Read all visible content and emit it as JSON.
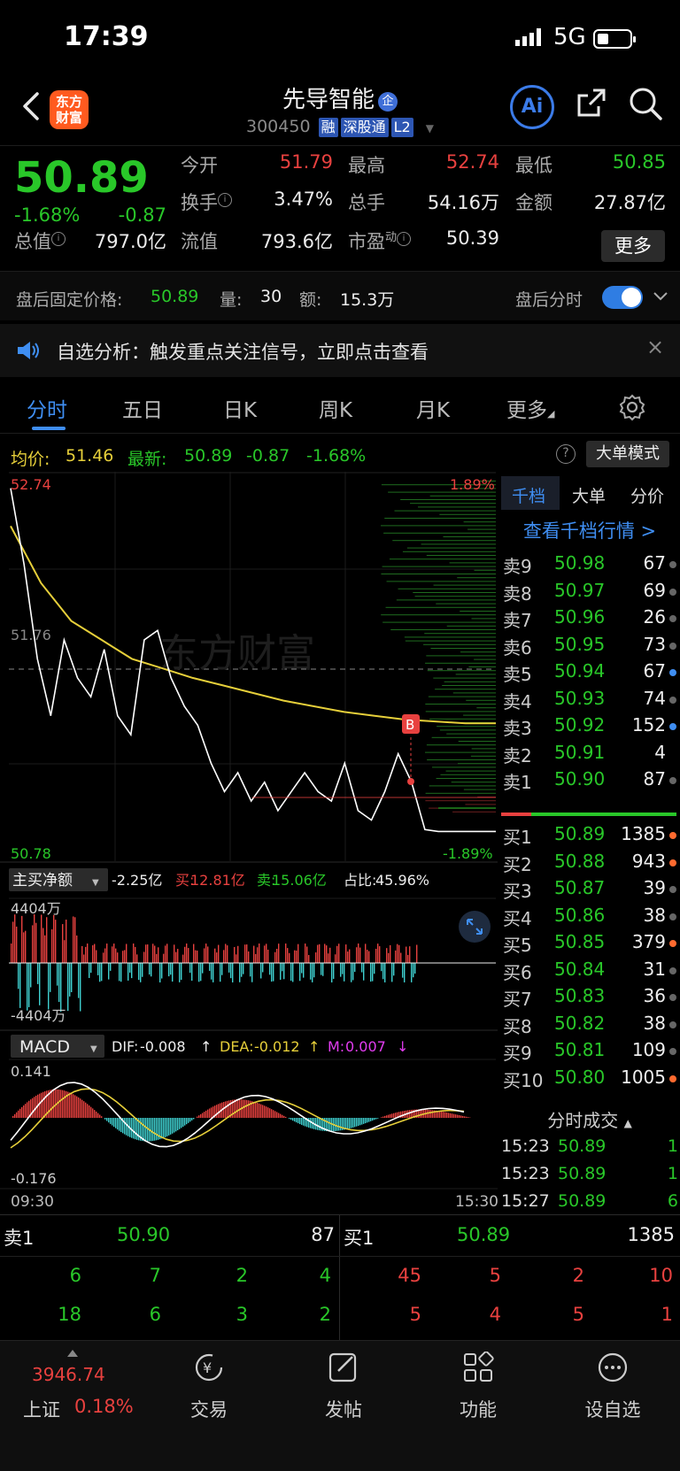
{
  "status_bar": {
    "time": "17:39",
    "network": "5G"
  },
  "header": {
    "app_logo_text": "东方财富",
    "stock_name": "先导智能",
    "stock_badge": "企",
    "stock_code": "300450",
    "tags": [
      "融",
      "深股通",
      "L2"
    ],
    "ai_label": "Ai"
  },
  "quote": {
    "last_price": "50.89",
    "change_pct": "-1.68%",
    "change_amt": "-0.87",
    "fields": [
      {
        "label": "今开",
        "value": "51.79",
        "color": "red"
      },
      {
        "label": "最高",
        "value": "52.74",
        "color": "red"
      },
      {
        "label": "最低",
        "value": "50.85",
        "color": "green"
      },
      {
        "label": "换手",
        "value": "3.47%",
        "color": "white"
      },
      {
        "label": "总手",
        "value": "54.16万",
        "color": "white"
      },
      {
        "label": "金额",
        "value": "27.87亿",
        "color": "white"
      },
      {
        "label": "总值",
        "value": "797.0亿",
        "color": "white"
      },
      {
        "label": "流值",
        "value": "793.6亿",
        "color": "white"
      },
      {
        "label": "市盈",
        "value": "50.39",
        "color": "white"
      }
    ],
    "pe_superscript": "动",
    "more_label": "更多"
  },
  "after_hours": {
    "label": "盘后固定价格:",
    "price": "50.89",
    "vol_label": "量:",
    "vol": "30",
    "amt_label": "额:",
    "amt": "15.3万",
    "toggle_label": "盘后分时",
    "toggle_on": true
  },
  "notice": {
    "text": "自选分析：触发重点关注信号，立即点击查看"
  },
  "tabs": [
    "分时",
    "五日",
    "日K",
    "周K",
    "月K",
    "更多"
  ],
  "active_tab": "分时",
  "avg_line": {
    "avg_label": "均价:",
    "avg_value": "51.46",
    "latest_label": "最新:",
    "latest_value": "50.89",
    "latest_chg": "-0.87",
    "latest_pct": "-1.68%"
  },
  "big_order_label": "大单模式",
  "chart_data": {
    "type": "line",
    "title": "",
    "price_max": "52.74",
    "price_min": "50.78",
    "pct_max": "1.89%",
    "pct_min": "-1.89%",
    "prev_close": "51.76",
    "watermark": "东方财富",
    "marker": "B",
    "time_start": "09:30",
    "time_end": "15:30",
    "ylim": [
      50.78,
      52.74
    ],
    "avg_series": [
      52.5,
      52.2,
      52.0,
      51.9,
      51.8,
      51.75,
      51.7,
      51.66,
      51.62,
      51.58,
      51.55,
      51.52,
      51.5,
      51.48,
      51.47,
      51.46,
      51.46
    ],
    "price_series": [
      52.7,
      52.3,
      51.8,
      51.5,
      51.9,
      51.7,
      51.6,
      51.85,
      51.5,
      51.4,
      51.9,
      51.95,
      51.7,
      51.55,
      51.45,
      51.25,
      51.1,
      51.2,
      51.05,
      51.15,
      51.0,
      51.1,
      51.2,
      51.1,
      51.05,
      51.25,
      51.0,
      50.95,
      51.1,
      51.3,
      51.15,
      50.9,
      50.89
    ],
    "net_buy": {
      "label": "主买净额",
      "value": "-2.25亿",
      "buy_label": "买:",
      "buy": "12.81亿",
      "sell_label": "卖:",
      "sell": "15.06亿",
      "ratio_label": "占比:",
      "ratio": "45.96%",
      "max_label": "4404万",
      "min_label": "-4404万"
    },
    "macd": {
      "label": "MACD",
      "dif_label": "DIF:",
      "dif": "-0.008",
      "dea_label": "DEA:",
      "dea": "-0.012",
      "m_label": "M:",
      "m": "0.007",
      "max_label": "0.141",
      "min_label": "-0.176"
    }
  },
  "order_book": {
    "tabs": [
      "千档",
      "大单",
      "分价"
    ],
    "link": "查看千档行情 >",
    "asks": [
      {
        "label": "卖9",
        "price": "50.98",
        "vol": "67",
        "dot": "grey"
      },
      {
        "label": "卖8",
        "price": "50.97",
        "vol": "69",
        "dot": "grey"
      },
      {
        "label": "卖7",
        "price": "50.96",
        "vol": "26",
        "dot": "grey"
      },
      {
        "label": "卖6",
        "price": "50.95",
        "vol": "73",
        "dot": "grey"
      },
      {
        "label": "卖5",
        "price": "50.94",
        "vol": "67",
        "dot": "blue"
      },
      {
        "label": "卖4",
        "price": "50.93",
        "vol": "74",
        "dot": "grey"
      },
      {
        "label": "卖3",
        "price": "50.92",
        "vol": "152",
        "dot": "blue"
      },
      {
        "label": "卖2",
        "price": "50.91",
        "vol": "4",
        "dot": "none"
      },
      {
        "label": "卖1",
        "price": "50.90",
        "vol": "87",
        "dot": "grey"
      }
    ],
    "bids": [
      {
        "label": "买1",
        "price": "50.89",
        "vol": "1385",
        "dot": "orange"
      },
      {
        "label": "买2",
        "price": "50.88",
        "vol": "943",
        "dot": "orange"
      },
      {
        "label": "买3",
        "price": "50.87",
        "vol": "39",
        "dot": "grey"
      },
      {
        "label": "买4",
        "price": "50.86",
        "vol": "38",
        "dot": "grey"
      },
      {
        "label": "买5",
        "price": "50.85",
        "vol": "379",
        "dot": "orange"
      },
      {
        "label": "买6",
        "price": "50.84",
        "vol": "31",
        "dot": "grey"
      },
      {
        "label": "买7",
        "price": "50.83",
        "vol": "36",
        "dot": "grey"
      },
      {
        "label": "买8",
        "price": "50.82",
        "vol": "38",
        "dot": "grey"
      },
      {
        "label": "买9",
        "price": "50.81",
        "vol": "109",
        "dot": "grey"
      },
      {
        "label": "买10",
        "price": "50.80",
        "vol": "1005",
        "dot": "orange"
      }
    ],
    "trades_header": "分时成交",
    "trades": [
      {
        "time": "15:23",
        "price": "50.89",
        "vol": "1"
      },
      {
        "time": "15:23",
        "price": "50.89",
        "vol": "1"
      },
      {
        "time": "15:27",
        "price": "50.89",
        "vol": "6"
      }
    ]
  },
  "level_summary": {
    "sell_label": "卖1",
    "sell_price": "50.90",
    "sell_vol": "87",
    "buy_label": "买1",
    "buy_price": "50.89",
    "buy_vol": "1385",
    "sell_queue": [
      [
        "6",
        "7",
        "2",
        "4"
      ],
      [
        "18",
        "6",
        "3",
        "2"
      ]
    ],
    "buy_queue": [
      [
        "45",
        "5",
        "2",
        "10"
      ],
      [
        "5",
        "4",
        "5",
        "1"
      ]
    ]
  },
  "bottom_nav": {
    "index_price": "3946.74",
    "index_name": "上证",
    "index_pct": "0.18%",
    "items": [
      "交易",
      "发帖",
      "功能",
      "设自选"
    ]
  },
  "colors": {
    "up": "#e8413f",
    "down": "#29c729",
    "accent": "#3f8ef2",
    "avg": "#e6cf3a"
  }
}
